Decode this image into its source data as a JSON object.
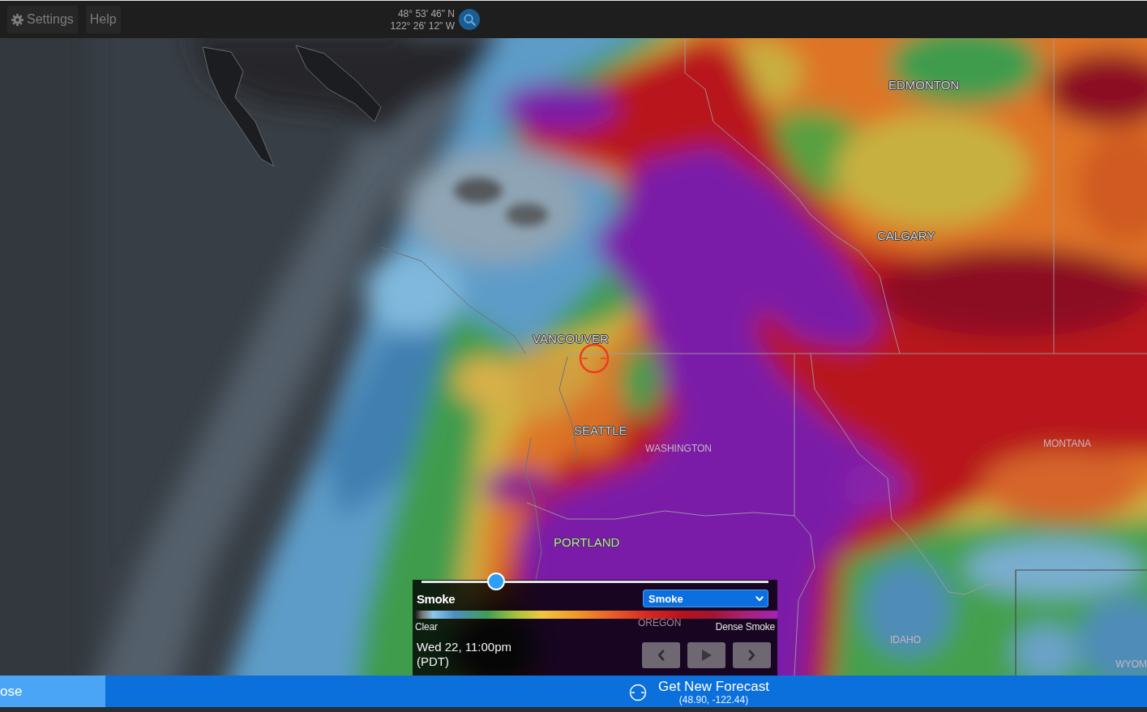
{
  "toolbar": {
    "settings_button": {
      "label": "Settings"
    },
    "help_button": {
      "label": "Help"
    },
    "location": {
      "latitude": "48° 53' 46\" N",
      "longitude": "122° 26' 12\" W"
    }
  },
  "map": {
    "labels": [
      {
        "text": "EDMONTON",
        "kind": "city"
      },
      {
        "text": "CALGARY",
        "kind": "city"
      },
      {
        "text": "VANCOUVER",
        "kind": "city"
      },
      {
        "text": "SEATTLE",
        "kind": "city"
      },
      {
        "text": "MONTANA",
        "kind": "region"
      },
      {
        "text": "WASHINGTON",
        "kind": "region"
      },
      {
        "text": "PORTLAND",
        "kind": "city"
      },
      {
        "text": "OREGON",
        "kind": "region"
      },
      {
        "text": "IDAHO",
        "kind": "region"
      },
      {
        "text": "WYOM",
        "kind": "region"
      }
    ]
  },
  "timeline": {
    "level": 0.215
  },
  "layer_panel": {
    "title": "Smoke",
    "dropdown": {
      "value": "Smoke"
    },
    "legend": {
      "min_label": "Clear",
      "max_label": "Dense Smoke"
    },
    "time": "Wed 22, 11:00pm (PDT)",
    "controls": [
      {
        "kind": "previous"
      },
      {
        "kind": "play"
      },
      {
        "kind": "next"
      }
    ]
  },
  "bottom_bar": {
    "left_button": {
      "label": "ose"
    },
    "forecast_button": {
      "label": "Get New Forecast",
      "coordinates": "(48.90, -122.44)"
    }
  }
}
